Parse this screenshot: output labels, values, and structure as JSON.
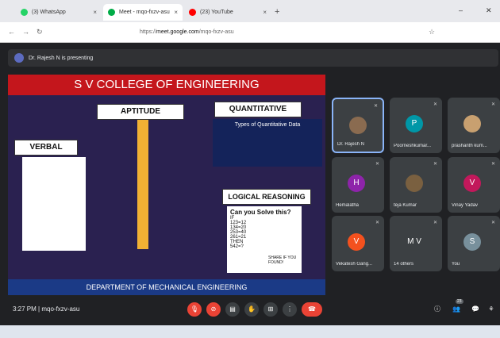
{
  "tabs": [
    {
      "title": "(3) WhatsApp",
      "color": "#25d366"
    },
    {
      "title": "Meet - mqo-fxzv-asu",
      "color": "#00ac47"
    },
    {
      "title": "(23) YouTube",
      "color": "#ff0000"
    }
  ],
  "addr": {
    "url_domain": "meet.google.com",
    "url_rest": "/mqo-fxzv-asu",
    "url_prefix": "https://"
  },
  "presenting": "Dr. Rajesh N is presenting",
  "slide": {
    "college": "S V COLLEGE OF ENGINEERING",
    "aptitude": "APTITUDE",
    "quantitative": "QUANTITATIVE",
    "quant_sub": "Types of Quantitative Data",
    "verbal": "VERBAL",
    "logical": "LOGICAL REASONING",
    "puzzle_title": "Can you Solve this?",
    "puzzle_lines": [
      "IF",
      "123=12",
      "134=20",
      "253=40",
      "261=21",
      "THEN",
      "542=?"
    ],
    "share": "SHARE IF YOU FOUND!",
    "dept": "DEPARTMENT OF MECHANICAL ENGINEERING"
  },
  "participants": [
    {
      "name": "Dr. Rajesh N",
      "initial": "",
      "color": "#8a6b50"
    },
    {
      "name": "Poorneshkumar...",
      "initial": "P",
      "color": "#0097a7"
    },
    {
      "name": "prashanth kum...",
      "initial": "",
      "color": "#c8a070"
    },
    {
      "name": "Hemalatha",
      "initial": "H",
      "color": "#8e24aa"
    },
    {
      "name": "teja Kumar",
      "initial": "",
      "color": "#7a6040"
    },
    {
      "name": "Vinay Yadav",
      "initial": "V",
      "color": "#c2185b"
    },
    {
      "name": "Vekatesh Gang...",
      "initial": "V",
      "color": "#f4511e"
    },
    {
      "name": "14 others",
      "initial": "M V",
      "color": "#3c4043"
    },
    {
      "name": "You",
      "initial": "S",
      "color": "#78909c"
    }
  ],
  "footer": {
    "time": "3:27 PM",
    "separator": "|",
    "meeting": "mqo-fxzv-asu",
    "people_count": "23"
  }
}
